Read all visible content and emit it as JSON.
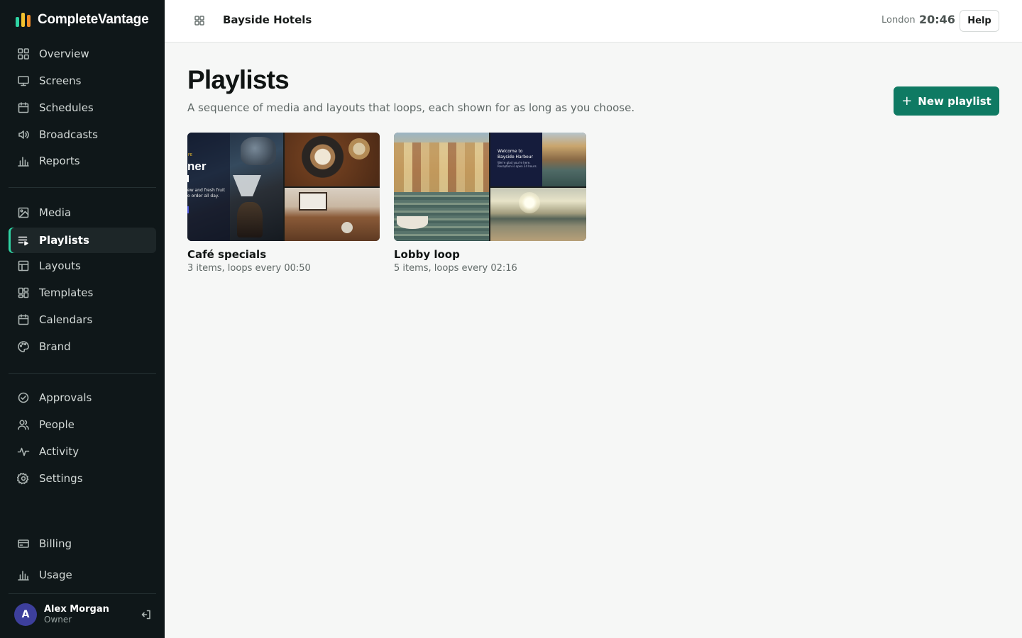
{
  "brand": {
    "name": "CompleteVantage",
    "bar_colors": [
      "#2fd3a3",
      "#f2c12e",
      "#f28c28"
    ]
  },
  "sidebar": {
    "groups": [
      [
        {
          "label": "Overview",
          "icon": "grid-icon"
        },
        {
          "label": "Screens",
          "icon": "monitor-icon"
        },
        {
          "label": "Schedules",
          "icon": "calendar-icon"
        },
        {
          "label": "Broadcasts",
          "icon": "speaker-icon"
        },
        {
          "label": "Reports",
          "icon": "bar-chart-icon"
        }
      ],
      [
        {
          "label": "Media",
          "icon": "image-icon"
        },
        {
          "label": "Playlists",
          "icon": "playlist-icon",
          "active": true
        },
        {
          "label": "Layouts",
          "icon": "layout-icon"
        },
        {
          "label": "Templates",
          "icon": "templates-icon"
        },
        {
          "label": "Calendars",
          "icon": "calendar-icon"
        },
        {
          "label": "Brand",
          "icon": "palette-icon"
        }
      ],
      [
        {
          "label": "Approvals",
          "icon": "check-circle-icon"
        },
        {
          "label": "People",
          "icon": "users-icon"
        },
        {
          "label": "Activity",
          "icon": "activity-icon"
        },
        {
          "label": "Settings",
          "icon": "gear-icon"
        }
      ],
      [
        {
          "label": "Billing",
          "icon": "credit-card-icon"
        },
        {
          "label": "Usage",
          "icon": "bar-chart-icon"
        }
      ]
    ],
    "user": {
      "initial": "A",
      "name": "Alex Morgan",
      "role": "Owner"
    },
    "accent_color": "#2fd3a3"
  },
  "topbar": {
    "workspace": "Bayside Hotels",
    "clock_city": "London",
    "clock_time": "20:46",
    "help_label": "Help"
  },
  "main": {
    "title": "Playlists",
    "subtitle": "A sequence of media and layouts that loops, each shown for as long as you choose.",
    "new_button_label": "New playlist",
    "playlists": [
      {
        "name": "Café specials",
        "meta": "3 items, loops every 00:50",
        "thumb_text": {
          "kicker": "FE",
          "headline": "ner",
          "body": "ew and fresh fruit\no order all day."
        }
      },
      {
        "name": "Lobby loop",
        "meta": "5 items, loops every 02:16",
        "thumb_text": {
          "headline": "Welcome to Bayside Harbour",
          "body": "We're glad you're here. Reception is open 24 hours."
        }
      }
    ]
  },
  "colors": {
    "primary_button": "#0f7a63",
    "sidebar_bg": "#0f1719"
  }
}
